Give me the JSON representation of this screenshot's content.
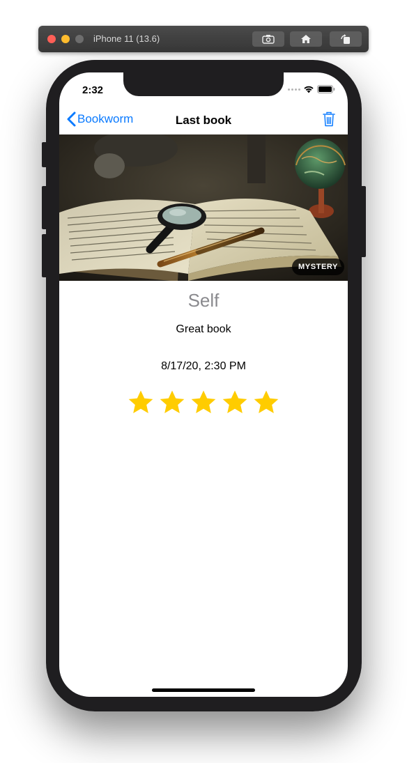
{
  "simulator": {
    "title": "iPhone 11 (13.6)",
    "buttons": [
      "screenshot-icon",
      "home-icon",
      "rotate-icon"
    ]
  },
  "status_bar": {
    "time": "2:32"
  },
  "nav": {
    "back_label": "Bookworm",
    "title": "Last book",
    "trash_icon": "trash-icon"
  },
  "book": {
    "genre": "MYSTERY",
    "author": "Self",
    "review": "Great book",
    "date": "8/17/20, 2:30 PM",
    "rating": 5,
    "max_rating": 5
  },
  "colors": {
    "accent": "#0a7aff",
    "star": "#ffcc00"
  }
}
